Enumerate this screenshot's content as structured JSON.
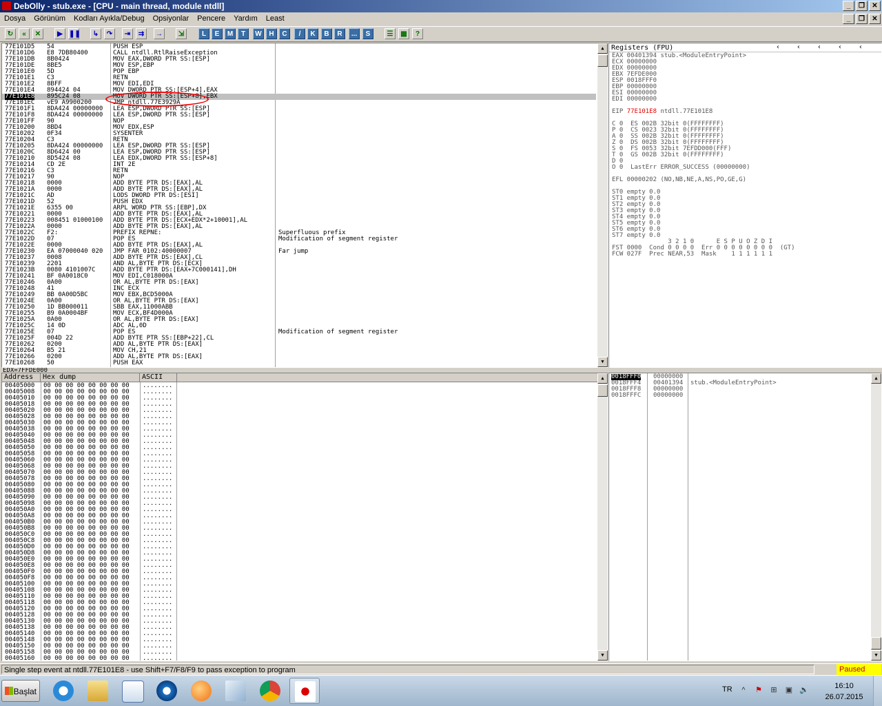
{
  "window": {
    "title": "DebOlly - stub.exe - [CPU - main thread, module ntdll]"
  },
  "menu": [
    "Dosya",
    "Görünüm",
    "Kodları Ayıkla/Debug",
    "Opsiyonlar",
    "Pencere",
    "Yardım",
    "Least"
  ],
  "toolbar": {
    "letters": [
      "L",
      "E",
      "M",
      "T",
      "W",
      "H",
      "C",
      "/",
      "K",
      "B",
      "R",
      "...",
      "S"
    ]
  },
  "disasm": {
    "rows": [
      [
        "77E101D5",
        "54",
        "PUSH ESP",
        ""
      ],
      [
        "77E101D6",
        "E8 7DB80400",
        "CALL ntdll.RtlRaiseException",
        ""
      ],
      [
        "77E101DB",
        "8B0424",
        "MOV EAX,DWORD PTR SS:[ESP]",
        ""
      ],
      [
        "77E101DE",
        "8BE5",
        "MOV ESP,EBP",
        ""
      ],
      [
        "77E101E0",
        "5D",
        "POP EBP",
        ""
      ],
      [
        "77E101E1",
        "C3",
        "RETN",
        ""
      ],
      [
        "77E101E2",
        "8BFF",
        "MOV EDI,EDI",
        ""
      ],
      [
        "77E101E4",
        "894424 04",
        "MOV DWORD PTR SS:[ESP+4],EAX",
        ""
      ],
      [
        "77E101E8",
        "895C24 08",
        "MOV DWORD PTR SS:[ESP+8],EBX",
        ""
      ],
      [
        "77E101EC",
        "vE9 A9900200",
        "JMP ntdll.77E3929A",
        ""
      ],
      [
        "77E101F1",
        "8DA424 00000000",
        "LEA ESP,DWORD PTR SS:[ESP]",
        ""
      ],
      [
        "77E101F8",
        "8DA424 00000000",
        "LEA ESP,DWORD PTR SS:[ESP]",
        ""
      ],
      [
        "77E101FF",
        "90",
        "NOP",
        ""
      ],
      [
        "77E10200",
        "8BD4",
        "MOV EDX,ESP",
        ""
      ],
      [
        "77E10202",
        "0F34",
        "SYSENTER",
        ""
      ],
      [
        "77E10204",
        "C3",
        "RETN",
        ""
      ],
      [
        "77E10205",
        "8DA424 00000000",
        "LEA ESP,DWORD PTR SS:[ESP]",
        ""
      ],
      [
        "77E1020C",
        "8D6424 00",
        "LEA ESP,DWORD PTR SS:[ESP]",
        ""
      ],
      [
        "77E10210",
        "8D5424 08",
        "LEA EDX,DWORD PTR SS:[ESP+8]",
        ""
      ],
      [
        "77E10214",
        "CD 2E",
        "INT 2E",
        ""
      ],
      [
        "77E10216",
        "C3",
        "RETN",
        ""
      ],
      [
        "77E10217",
        "90",
        "NOP",
        ""
      ],
      [
        "77E10218",
        "0000",
        "ADD BYTE PTR DS:[EAX],AL",
        ""
      ],
      [
        "77E1021A",
        "0000",
        "ADD BYTE PTR DS:[EAX],AL",
        ""
      ],
      [
        "77E1021C",
        "AD",
        "LODS DWORD PTR DS:[ESI]",
        ""
      ],
      [
        "77E1021D",
        "52",
        "PUSH EDX",
        ""
      ],
      [
        "77E1021E",
        "6355 00",
        "ARPL WORD PTR SS:[EBP],DX",
        ""
      ],
      [
        "77E10221",
        "0000",
        "ADD BYTE PTR DS:[EAX],AL",
        ""
      ],
      [
        "77E10223",
        "008451 01000100",
        "ADD BYTE PTR DS:[ECX+EDX*2+10001],AL",
        ""
      ],
      [
        "77E1022A",
        "0000",
        "ADD BYTE PTR DS:[EAX],AL",
        ""
      ],
      [
        "77E1022C",
        "F2:",
        "PREFIX REPNE:",
        "Superfluous prefix"
      ],
      [
        "77E1022D",
        "07",
        "POP ES",
        "Modification of segment register"
      ],
      [
        "77E1022E",
        "0000",
        "ADD BYTE PTR DS:[EAX],AL",
        ""
      ],
      [
        "77E10230",
        "EA 07000040 020",
        "JMP FAR 0102:40000007",
        "Far jump"
      ],
      [
        "77E10237",
        "0008",
        "ADD BYTE PTR DS:[EAX],CL",
        ""
      ],
      [
        "77E10239",
        "2201",
        "AND AL,BYTE PTR DS:[ECX]",
        ""
      ],
      [
        "77E1023B",
        "0080 4101007C",
        "ADD BYTE PTR DS:[EAX+7C000141],DH",
        ""
      ],
      [
        "77E10241",
        "BF 0A0018C0",
        "MOV EDI,C018000A",
        ""
      ],
      [
        "77E10246",
        "0A00",
        "OR AL,BYTE PTR DS:[EAX]",
        ""
      ],
      [
        "77E10248",
        "41",
        "INC ECX",
        ""
      ],
      [
        "77E10249",
        "BB 0A00D5BC",
        "MOV EBX,BCD5000A",
        ""
      ],
      [
        "77E1024E",
        "0A00",
        "OR AL,BYTE PTR DS:[EAX]",
        ""
      ],
      [
        "77E10250",
        "1D BB000011",
        "SBB EAX,11000ABB",
        ""
      ],
      [
        "77E10255",
        "B9 0A0004BF",
        "MOV ECX,BF4D000A",
        ""
      ],
      [
        "77E1025A",
        "0A00",
        "OR AL,BYTE PTR DS:[EAX]",
        ""
      ],
      [
        "77E1025C",
        "14 0D",
        "ADC AL,0D",
        ""
      ],
      [
        "77E1025E",
        "07",
        "POP ES",
        "Modification of segment register"
      ],
      [
        "77E1025F",
        "004D 22",
        "ADD BYTE PTR SS:[EBP+22],CL",
        ""
      ],
      [
        "77E10262",
        "0200",
        "ADD AL,BYTE PTR DS:[EAX]",
        ""
      ],
      [
        "77E10264",
        "B5 21",
        "MOV CH,21",
        ""
      ],
      [
        "77E10266",
        "0200",
        "ADD AL,BYTE PTR DS:[EAX]",
        ""
      ],
      [
        "77E10268",
        "50",
        "PUSH EAX",
        ""
      ]
    ],
    "highlight_address": "77E101E8"
  },
  "info_line": "EDX=7FFDE000",
  "dump": {
    "headers": [
      "Address",
      "Hex dump",
      "ASCII"
    ],
    "start": 4214784,
    "count": 45,
    "hex": "00 00 00 00 00 00 00 00",
    "ascii": "........"
  },
  "registers": {
    "header": "Registers (FPU)",
    "lines": [
      "EAX 00401394 stub.<ModuleEntryPoint>",
      "ECX 00000000",
      "EDX 00000000",
      "EBX 7EFDE000",
      "ESP 0018FFF0",
      "EBP 00000000",
      "ESI 00000000",
      "EDI 00000000",
      "",
      "EIP 77E101E8 ntdll.77E101E8",
      "",
      "C 0  ES 002B 32bit 0(FFFFFFFF)",
      "P 0  CS 0023 32bit 0(FFFFFFFF)",
      "A 0  SS 002B 32bit 0(FFFFFFFF)",
      "Z 0  DS 002B 32bit 0(FFFFFFFF)",
      "S 0  FS 0053 32bit 7EFDD000(FFF)",
      "T 0  GS 002B 32bit 0(FFFFFFFF)",
      "D 0",
      "O 0  LastErr ERROR_SUCCESS (00000000)",
      "",
      "EFL 00000202 (NO,NB,NE,A,NS,PO,GE,G)",
      "",
      "ST0 empty 0.0",
      "ST1 empty 0.0",
      "ST2 empty 0.0",
      "ST3 empty 0.0",
      "ST4 empty 0.0",
      "ST5 empty 0.0",
      "ST6 empty 0.0",
      "ST7 empty 0.0",
      "               3 2 1 0      E S P U O Z D I",
      "FST 0000  Cond 0 0 0 0  Err 0 0 0 0 0 0 0 0  (GT)",
      "FCW 027F  Prec NEAR,53  Mask    1 1 1 1 1 1"
    ],
    "eip_value": "77E101E8"
  },
  "stack": {
    "rows": [
      [
        "0018FFF0",
        "00000000",
        ""
      ],
      [
        "0018FFF4",
        "00401394",
        "stub.<ModuleEntryPoint>"
      ],
      [
        "0018FFF8",
        "00000000",
        ""
      ],
      [
        "0018FFFC",
        "00000000",
        ""
      ]
    ]
  },
  "status": {
    "message": "Single step event at ntdll.77E101E8 - use Shift+F7/F8/F9 to pass exception to program",
    "state": "Paused"
  },
  "taskbar": {
    "start_label": "Başlat",
    "apps": [
      "internet-explorer-icon",
      "file-explorer-icon",
      "media-player-icon",
      "browser-icon",
      "app-icon",
      "notepad-icon",
      "chrome-icon",
      "ollydbg-icon"
    ],
    "language": "TR",
    "time": "16:10",
    "date": "26.07.2015"
  },
  "colors": {
    "highlight_red": "#e00000",
    "paused_bg": "#ffff00",
    "annotation_oval": "#ee0000"
  }
}
